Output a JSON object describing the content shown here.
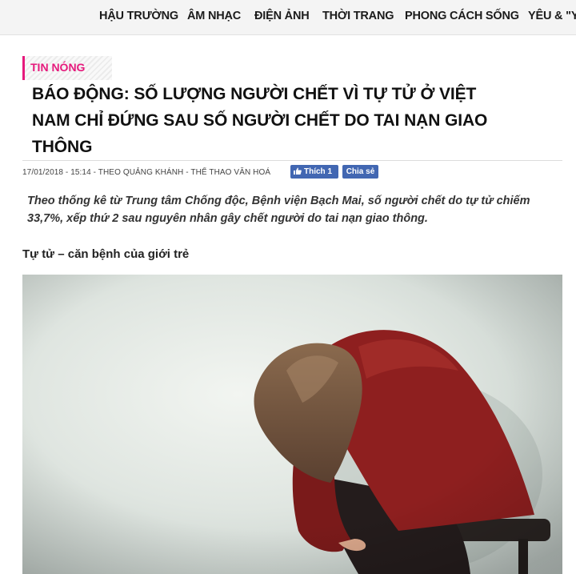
{
  "nav": {
    "items": [
      "HẬU TRƯỜNG",
      "ÂM NHẠC",
      "ĐIỆN ẢNH",
      "THỜI TRANG",
      "PHONG CÁCH SỐNG",
      "YÊU & \"YÊ"
    ]
  },
  "article": {
    "category": "TIN NÓNG",
    "title_lines": [
      "BÁO ĐỘNG: SỐ LƯỢNG NGƯỜI CHẾT VÌ TỰ TỬ Ở VIỆT",
      "NAM CHỈ ĐỨNG SAU SỐ NGƯỜI CHẾT DO TAI NẠN GIAO",
      "THÔNG"
    ],
    "meta": "17/01/2018 - 15:14 - THEO QUẢNG KHÁNH - THỂ THAO VĂN HOÁ",
    "like_label": "Thích 1",
    "share_label": "Chia sẻ",
    "lead_lines": [
      "Theo thống kê từ Trung tâm Chống độc, Bệnh viện Bạch Mai, số người chết do tự tử chiếm",
      "33,7%, xếp thứ 2 sau nguyên nhân gây chết người do tai nạn giao thông."
    ],
    "subheading": "Tự tử – căn bệnh của giới trẻ"
  },
  "colors": {
    "accent": "#e6197c",
    "facebook": "#4267b2",
    "sweater": "#8e1f1f"
  },
  "icons": {
    "like": "thumbs-up-icon"
  }
}
